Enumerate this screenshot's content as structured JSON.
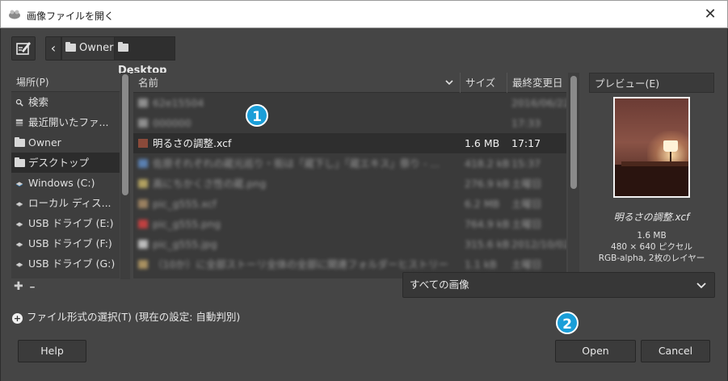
{
  "window": {
    "title": "画像ファイルを開く",
    "close_glyph": "✕"
  },
  "pathbar": {
    "back_glyph": "‹",
    "crumbs": [
      "Owner",
      "Desktop"
    ]
  },
  "places": {
    "header": "場所(P)",
    "items": [
      {
        "label": "検索",
        "icon": "search-icon"
      },
      {
        "label": "最近開いたファ...",
        "icon": "recent-icon"
      },
      {
        "label": "Owner",
        "icon": "folder-icon"
      },
      {
        "label": "デスクトップ",
        "icon": "folder-icon"
      },
      {
        "label": "Windows (C:)",
        "icon": "drive-icon"
      },
      {
        "label": "ローカル ディス...",
        "icon": "drive-icon"
      },
      {
        "label": "USB ドライブ (E:)",
        "icon": "usb-icon"
      },
      {
        "label": "USB ドライブ (F:)",
        "icon": "usb-icon"
      },
      {
        "label": "USB ドライブ (G:)",
        "icon": "usb-icon"
      }
    ],
    "add_glyph": "✚",
    "remove_glyph": "━"
  },
  "files": {
    "col_name": "名前",
    "col_size": "サイズ",
    "col_date": "最終変更日",
    "rows": [
      {
        "name": "62e15504",
        "size": "",
        "date": "2016/06/22",
        "blurred": true
      },
      {
        "name": "000000",
        "size": "",
        "date": "17:33",
        "blurred": true
      },
      {
        "name": "明るさの調整.xcf",
        "size": "1.6 MB",
        "date": "17:17",
        "blurred": false
      },
      {
        "name": "佐原それぞれの蔵元巡り・街は「蔵下し」「蔵エキス」祭り - ...",
        "size": "418.2 kB",
        "date": "15:37",
        "blurred": true
      },
      {
        "name": "高にちかくさ性の蔵.png",
        "size": "276.9 kB",
        "date": "土曜日",
        "blurred": true
      },
      {
        "name": "pic_g555.xcf",
        "size": "6.2 MB",
        "date": "土曜日",
        "blurred": true
      },
      {
        "name": "pic_g555.png",
        "size": "764.9 kB",
        "date": "土曜日",
        "blurred": true
      },
      {
        "name": "pic_g555.jpg",
        "size": "315.6 kB",
        "date": "2012/10/02",
        "blurred": true
      },
      {
        "name": "（10か）に全部ストーリ全体の全部に関連フォルダーヒストリー",
        "size": "1.1 kB",
        "date": "土曜日",
        "blurred": true
      }
    ]
  },
  "preview": {
    "header": "プレビュー(E)",
    "filename": "明るさの調整.xcf",
    "size": "1.6 MB",
    "dimensions": "480 × 640 ピクセル",
    "mode": "RGB-alpha, 2枚のレイヤー"
  },
  "filter": {
    "selected": "すべての画像"
  },
  "expander": {
    "label": "ファイル形式の選択(T) (現在の設定: 自動判別)"
  },
  "buttons": {
    "help": "Help",
    "open": "Open",
    "cancel": "Cancel"
  },
  "badges": {
    "one": "1",
    "two": "2"
  },
  "colors": {
    "background": "#454545",
    "badge": "#1a9ed8",
    "selected_row": "#2e2e2e"
  }
}
